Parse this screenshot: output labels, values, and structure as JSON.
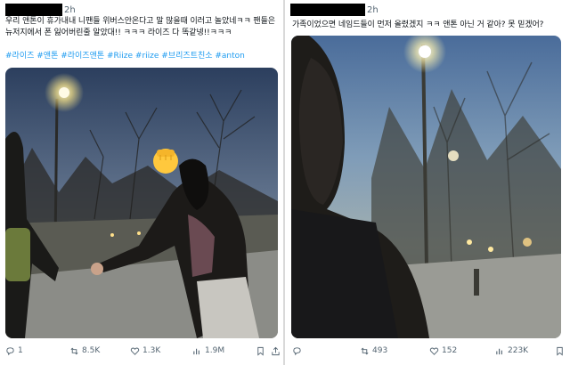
{
  "left_tweet": {
    "time": "2h",
    "text": "우리 앤톤이 휴가내내 니팬들 위버스안온다고 말 많을때 이러고 놀았네ㅋㅋ 팬들은 뉴저지에서 폰 잃어버린줄 알았대!! ㅋㅋㅋ 라이즈 다 똑같넹!!ㅋㅋㅋ",
    "hashtags": "#라이즈 #앤톤 #라이즈앤톤 #Riize #riize #브리즈트친소 #anton",
    "stats": {
      "replies": "1",
      "retweets": "8.5K",
      "likes": "1.3K",
      "views": "1.9M"
    }
  },
  "right_tweet": {
    "time": "2h",
    "text": "가족이었으면 네임드들이 먼저 올렸겠지 ㅋㅋ 앤톤 아닌 거 같아? 못 믿겠어?",
    "stats": {
      "retweets": "493",
      "likes": "152",
      "views": "223K"
    }
  },
  "icons": [
    "reply-icon",
    "retweet-icon",
    "like-icon",
    "views-icon",
    "bookmark-icon",
    "share-icon"
  ],
  "colors": {
    "text": "#0f1419",
    "muted": "#536471",
    "hashtag": "#1d9bf0"
  }
}
